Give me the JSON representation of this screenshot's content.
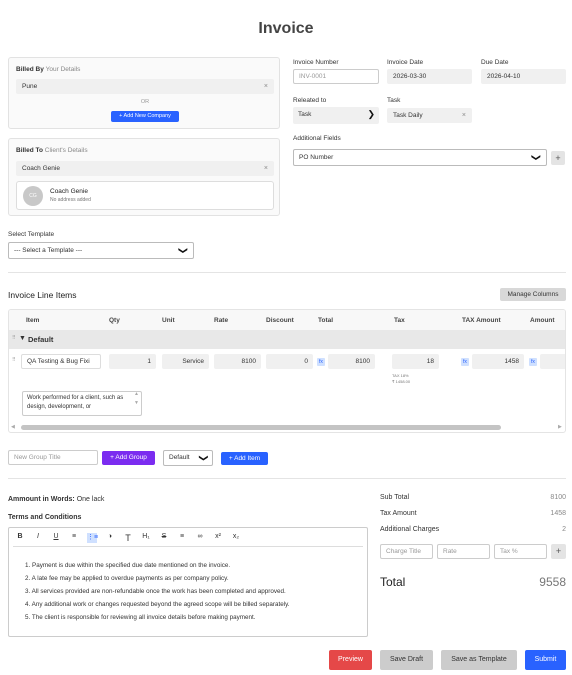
{
  "page": {
    "title": "Invoice"
  },
  "billed_by": {
    "label": "Billed By",
    "sub": "Your Details",
    "value": "Pune",
    "or": "OR",
    "add_company": "+ Add New Company"
  },
  "billed_to": {
    "label": "Billed To",
    "sub": "Client's Details",
    "value": "Coach Genie",
    "avatar": "CG",
    "client_name": "Coach Genie",
    "client_address": "No address added"
  },
  "invoice": {
    "number_label": "Invoice Number",
    "number_placeholder": "INV-0001",
    "date_label": "Invoice Date",
    "date_value": "2026-03-30",
    "due_label": "Due Date",
    "due_value": "2026-04-10",
    "related_label": "Releated to",
    "related_value": "Task",
    "task_label": "Task",
    "task_value": "Task Daily",
    "additional_label": "Additional Fields",
    "additional_value": "PO Number"
  },
  "template": {
    "label": "Select Template",
    "value": "--- Select a Template ---"
  },
  "line_items": {
    "title": "Invoice Line Items",
    "manage_columns": "Manage Columns",
    "columns": [
      "Item",
      "Qty",
      "Unit",
      "Rate",
      "Discount",
      "Total",
      "Tax",
      "TAX Amount",
      "Amount"
    ],
    "group_name": "Default",
    "row": {
      "item": "QA Testing & Bug Fixi",
      "qty": "1",
      "unit": "Service",
      "rate": "8100",
      "discount": "0",
      "total": "8100",
      "tax": "18",
      "tax_note1": "TAX 18%",
      "tax_note2": "₹ 1458.00",
      "tax_amount": "1458",
      "fx": "fx",
      "description": "Work performed for a client, such as design, development, or"
    },
    "group_placeholder": "New Group Title",
    "add_group": "+ Add Group",
    "group_select": "Default",
    "add_item": "+ Add Item"
  },
  "words": {
    "label": "Ammount in Words:",
    "value": "One lack"
  },
  "terms": {
    "label": "Terms and Conditions",
    "toolbar": [
      "B",
      "I",
      "U",
      "≡",
      "⋮≡",
      "◑",
      "T",
      "H₁",
      "S",
      "≡",
      "∞",
      "x²",
      "x₂"
    ],
    "items": [
      "1. Payment is due within the specified due date mentioned on the invoice.",
      "2. A late fee may be applied to overdue payments as per company policy.",
      "3. All services provided are non-refundable once the work has been completed and approved.",
      "4. Any additional work or changes requested beyond the agreed scope will be billed separately.",
      "5. The client is responsible for reviewing all invoice details before making payment."
    ]
  },
  "summary": {
    "sub_total_label": "Sub Total",
    "sub_total": "8100",
    "tax_label": "Tax Amount",
    "tax": "1458",
    "charges_label": "Additional Charges",
    "charges": "2",
    "charge_title_ph": "Charge Title",
    "rate_ph": "Rate",
    "tax_ph": "Tax %",
    "total_label": "Total",
    "total": "9558"
  },
  "actions": {
    "preview": "Preview",
    "save_draft": "Save Draft",
    "save_template": "Save as Template",
    "submit": "Submit"
  },
  "colors": {
    "primary": "#2962ff",
    "purple": "#7b2cf0",
    "danger": "#e54848"
  }
}
